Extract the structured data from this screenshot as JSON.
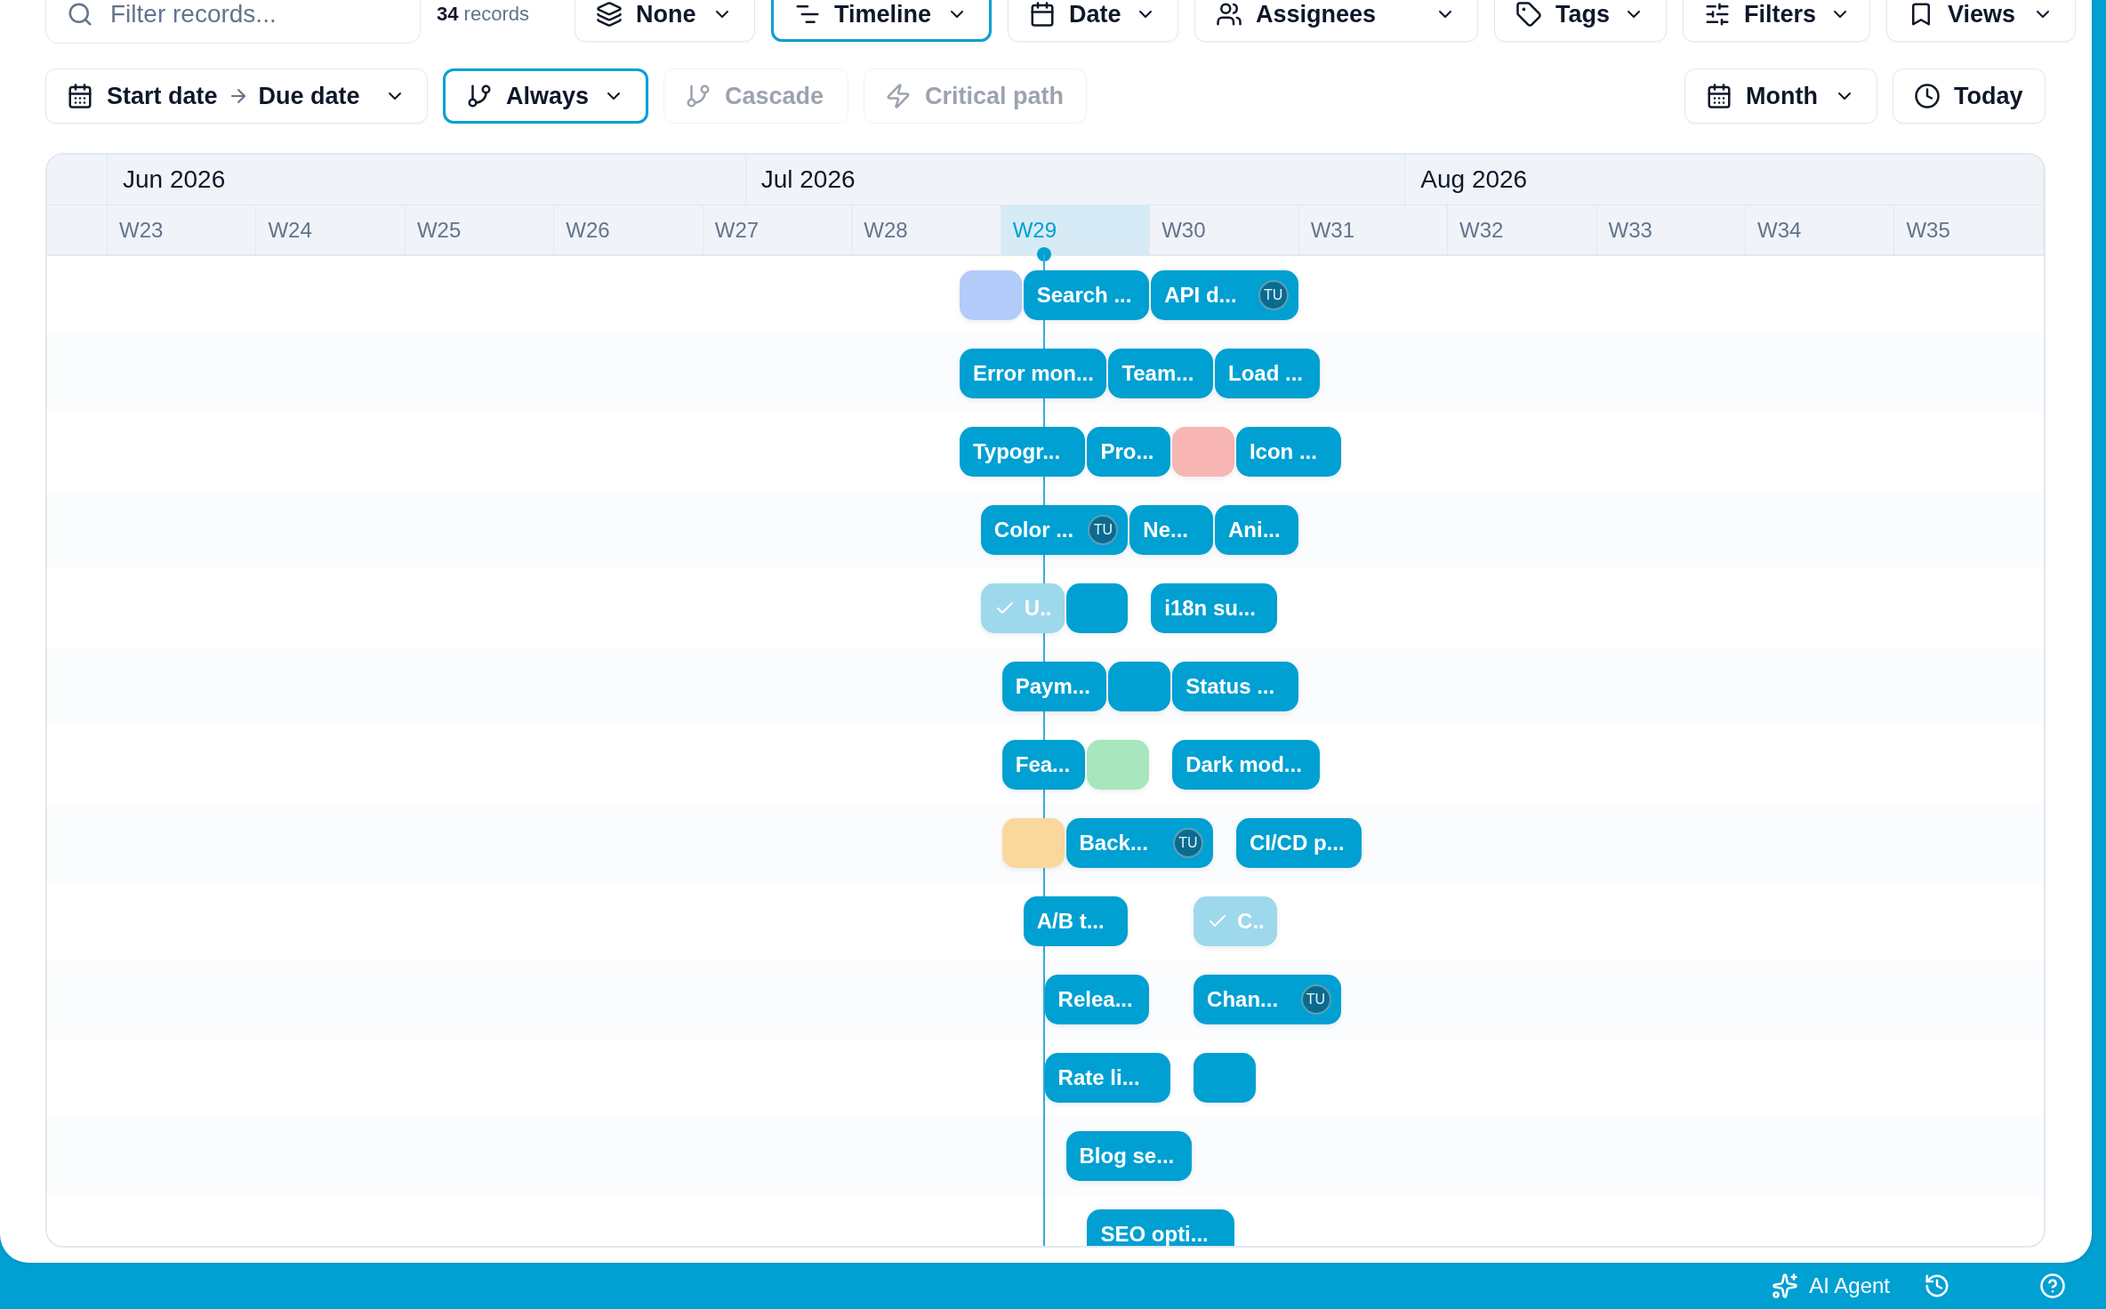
{
  "toolbar": {
    "search": {
      "placeholder": "Filter records..."
    },
    "record_count": {
      "count": "34",
      "label": "records"
    },
    "buttons": [
      {
        "kind": "group",
        "label": "None",
        "active": false
      },
      {
        "kind": "view",
        "label": "Timeline",
        "active": true
      },
      {
        "kind": "date",
        "label": "Date",
        "active": false
      },
      {
        "kind": "people",
        "label": "Assignees",
        "active": false
      },
      {
        "kind": "tag",
        "label": "Tags",
        "active": false
      },
      {
        "kind": "filter",
        "label": "Filters",
        "active": false
      },
      {
        "kind": "bookmark",
        "label": "Views",
        "active": false
      }
    ]
  },
  "options_bar": {
    "date_range": {
      "start": "Start date",
      "end": "Due date"
    },
    "dependency_buttons": [
      {
        "kind": "branch",
        "label": "Always",
        "active": true,
        "disabled": false,
        "dropdown": true
      },
      {
        "kind": "branch",
        "label": "Cascade",
        "active": false,
        "disabled": true,
        "dropdown": false
      },
      {
        "kind": "bolt",
        "label": "Critical path",
        "active": false,
        "disabled": true,
        "dropdown": false
      }
    ],
    "scale": {
      "label": "Month"
    },
    "today_button": {
      "label": "Today"
    }
  },
  "timeline": {
    "months": [
      {
        "label": "Jun 2026"
      },
      {
        "label": "Jul 2026"
      },
      {
        "label": "Aug 2026"
      }
    ],
    "weeks": [
      {
        "label": "W23",
        "current": false
      },
      {
        "label": "W24",
        "current": false
      },
      {
        "label": "W25",
        "current": false
      },
      {
        "label": "W26",
        "current": false
      },
      {
        "label": "W27",
        "current": false
      },
      {
        "label": "W28",
        "current": false
      },
      {
        "label": "W29",
        "current": true
      },
      {
        "label": "W30",
        "current": false
      },
      {
        "label": "W31",
        "current": false
      },
      {
        "label": "W32",
        "current": false
      },
      {
        "label": "W33",
        "current": false
      },
      {
        "label": "W34",
        "current": false
      },
      {
        "label": "W35",
        "current": false
      }
    ],
    "rows": [
      {
        "bars": [
          {
            "color": "#b3cbf9",
            "done": false
          },
          {
            "label": "Search ...",
            "color": "#00a0d2",
            "done": false
          },
          {
            "label": "API d...",
            "color": "#00a0d2",
            "done": false,
            "assignee": "TU"
          }
        ]
      },
      {
        "bars": [
          {
            "label": "Error mon...",
            "color": "#00a0d2",
            "done": false
          },
          {
            "label": "Team...",
            "color": "#00a0d2",
            "done": false
          },
          {
            "label": "Load ...",
            "color": "#00a0d2",
            "done": false
          }
        ]
      },
      {
        "bars": [
          {
            "label": "Typogr...",
            "color": "#00a0d2",
            "done": false
          },
          {
            "label": "Pro...",
            "color": "#00a0d2",
            "done": false
          },
          {
            "color": "#f7b6b3",
            "done": false
          },
          {
            "label": "Icon ...",
            "color": "#00a0d2",
            "done": false
          }
        ]
      },
      {
        "bars": [
          {
            "label": "Color ...",
            "color": "#00a0d2",
            "done": false,
            "assignee": "TU"
          },
          {
            "label": "Ne...",
            "color": "#00a0d2",
            "done": false
          },
          {
            "label": "Ani...",
            "color": "#00a0d2",
            "done": false
          }
        ]
      },
      {
        "bars": [
          {
            "label": "U..",
            "color": "#9dd8ec",
            "done": true
          },
          {
            "color": "#00a0d2",
            "done": false
          },
          {
            "label": "i18n su...",
            "color": "#00a0d2",
            "done": false
          }
        ]
      },
      {
        "bars": [
          {
            "label": "Paym...",
            "color": "#00a0d2",
            "done": false
          },
          {
            "color": "#00a0d2",
            "done": false
          },
          {
            "label": "Status ...",
            "color": "#00a0d2",
            "done": false
          }
        ]
      },
      {
        "bars": [
          {
            "label": "Fea...",
            "color": "#00a0d2",
            "done": false
          },
          {
            "color": "#a8e6bd",
            "done": false
          },
          {
            "label": "Dark mod...",
            "color": "#00a0d2",
            "done": false
          }
        ]
      },
      {
        "bars": [
          {
            "color": "#fad89d",
            "done": false
          },
          {
            "label": "Back...",
            "color": "#00a0d2",
            "done": false,
            "assignee": "TU"
          },
          {
            "label": "CI/CD p...",
            "color": "#00a0d2",
            "done": false
          }
        ]
      },
      {
        "bars": [
          {
            "label": "A/B t...",
            "color": "#00a0d2",
            "done": false
          },
          {
            "label": "C..",
            "color": "#9dd8ec",
            "done": true
          }
        ]
      },
      {
        "bars": [
          {
            "label": "Relea...",
            "color": "#00a0d2",
            "done": false
          },
          {
            "label": "Chan...",
            "color": "#00a0d2",
            "done": false,
            "assignee": "TU"
          }
        ]
      },
      {
        "bars": [
          {
            "label": "Rate li...",
            "color": "#00a0d2",
            "done": false
          },
          {
            "color": "#00a0d2",
            "done": false
          }
        ]
      },
      {
        "bars": [
          {
            "label": "Blog se...",
            "color": "#00a0d2",
            "done": false
          }
        ]
      },
      {
        "bars": [
          {
            "label": "SEO opti...",
            "color": "#00a0d2",
            "done": false
          }
        ]
      }
    ]
  },
  "footer": {
    "ai_agent": {
      "label": "AI Agent"
    }
  }
}
